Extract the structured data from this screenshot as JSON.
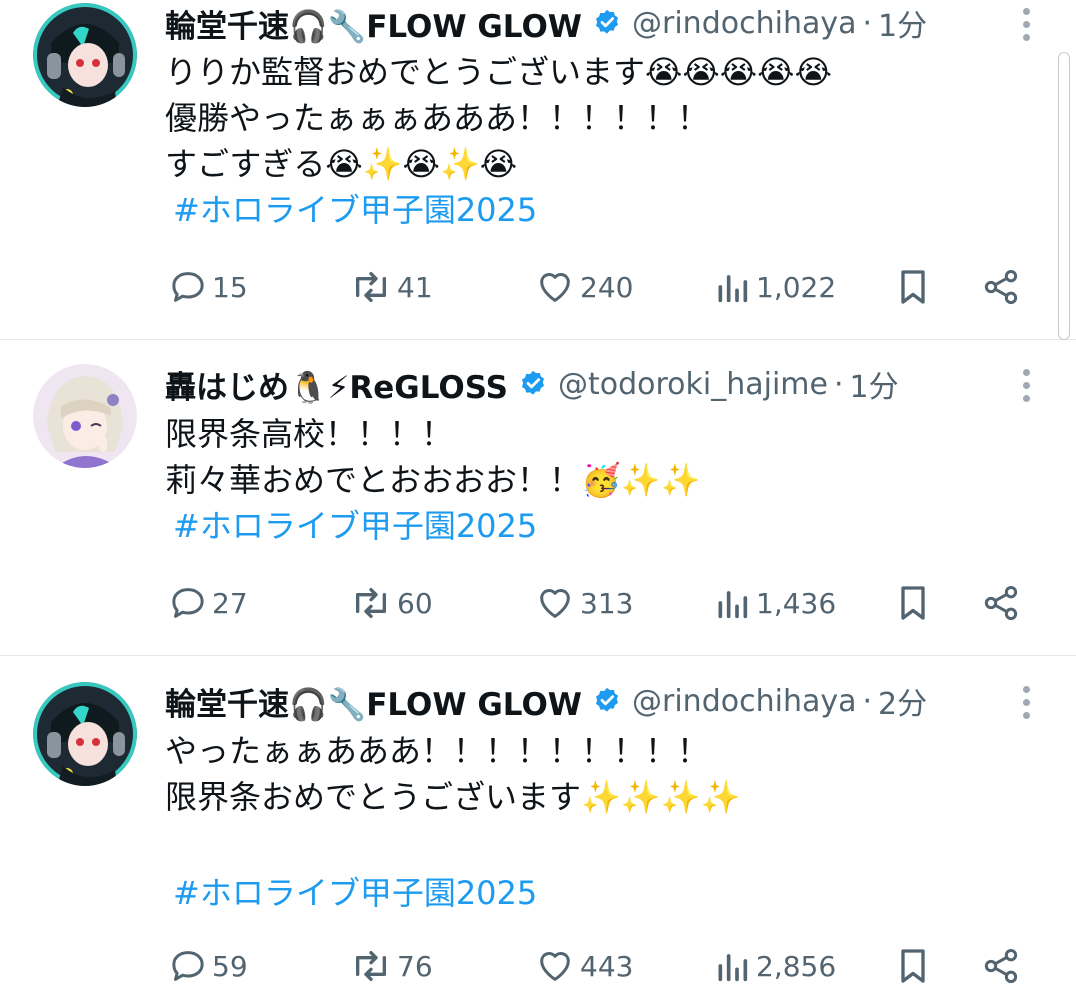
{
  "tweets": [
    {
      "author_name": "輪堂千速🎧🔧FLOW GLOW",
      "handle": "@rindochihaya",
      "time": "1分",
      "lines": [
        "りりか監督おめでとうございます😭😭😭😭😭",
        "優勝やったぁぁぁあああ！！！！！！",
        "すごすぎる😭✨😭✨😭"
      ],
      "hashtag": "#ホロライブ甲子園2025",
      "replies": "15",
      "reposts": "41",
      "likes": "240",
      "views": "1,022"
    },
    {
      "author_name": "轟はじめ🐧⚡ReGLOSS",
      "handle": "@todoroki_hajime",
      "time": "1分",
      "lines": [
        "限界条高校！！！！",
        "莉々華おめでとおおおお！！🥳✨✨"
      ],
      "hashtag": "#ホロライブ甲子園2025",
      "replies": "27",
      "reposts": "60",
      "likes": "313",
      "views": "1,436"
    },
    {
      "author_name": "輪堂千速🎧🔧FLOW GLOW",
      "handle": "@rindochihaya",
      "time": "2分",
      "lines": [
        "やったぁぁあああ！！！！！！！！！",
        "限界条おめでとうございます✨✨✨✨",
        ""
      ],
      "hashtag": "#ホロライブ甲子園2025",
      "replies": "59",
      "reposts": "76",
      "likes": "443",
      "views": "2,856"
    }
  ],
  "icons": {
    "verified": "verified-badge-icon",
    "reply": "reply-icon",
    "repost": "repost-icon",
    "like": "heart-icon",
    "views": "views-icon",
    "bookmark": "bookmark-icon",
    "share": "share-icon",
    "more": "more-icon"
  },
  "colors": {
    "link": "#1d9bf0",
    "secondary": "#536471",
    "verified": "#1d9bf0"
  }
}
